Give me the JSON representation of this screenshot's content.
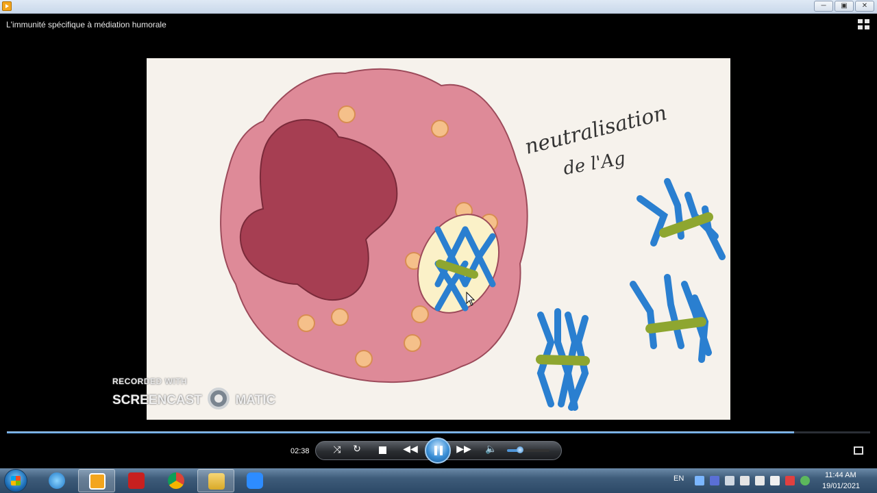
{
  "window": {
    "min_label": "─",
    "max_label": "▣",
    "close_label": "✕"
  },
  "media": {
    "title": "L'immunité spécifique à médiation humorale"
  },
  "video": {
    "handwriting_line1": "neutralisation",
    "handwriting_line2": "de l'Ag",
    "watermark_line1": "RECORDED WITH",
    "watermark_left": "SCREENCAST",
    "watermark_right": "MATIC"
  },
  "player": {
    "elapsed_time": "02:38",
    "progress_fraction": 0.912,
    "volume_fraction": 0.3
  },
  "taskbar": {
    "language": "EN",
    "clock_time": "11:44 AM",
    "clock_date": "19/01/2021"
  }
}
